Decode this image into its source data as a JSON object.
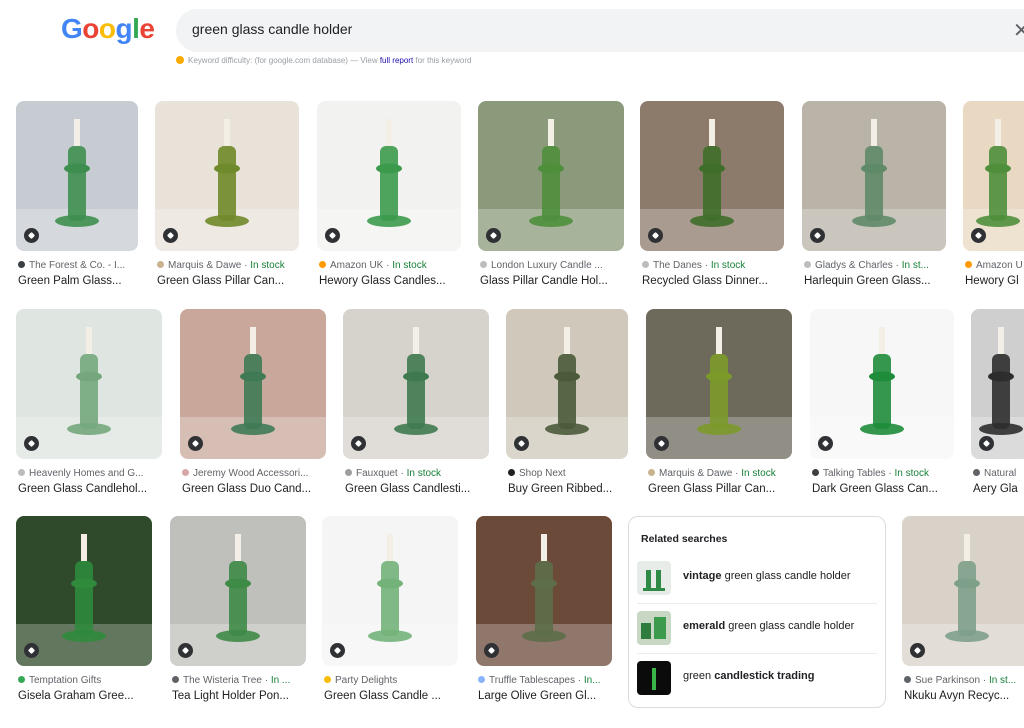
{
  "logo": {
    "letters": [
      "G",
      "o",
      "o",
      "g",
      "l",
      "e"
    ],
    "colors": [
      "#4285f4",
      "#ea4335",
      "#fbbc05",
      "#4285f4",
      "#34a853",
      "#ea4335"
    ]
  },
  "search": {
    "query": "green glass candle holder",
    "clear_icon": "close-icon"
  },
  "keyword": {
    "label": "Keyword difficulty:",
    "db": "(for google.com database) — View",
    "link": "full report",
    "tail": "for this keyword"
  },
  "results": [
    {
      "source": "The Forest & Co. - I...",
      "stock": "",
      "title": "Green Palm Glass...",
      "fav": "#3c4043",
      "bg": "#c7ccd2",
      "fg": "#3e8f4f"
    },
    {
      "source": "Marquis & Dawe",
      "stock": "In stock",
      "title": "Green Glass Pillar Can...",
      "fav": "#c9b38f",
      "bg": "#e8e2d8",
      "fg": "#6f8a2a"
    },
    {
      "source": "Amazon UK",
      "stock": "In stock",
      "title": "Hewory Glass Candles...",
      "fav": "#ff9900",
      "bg": "#f2f2f0",
      "fg": "#3c9a4d"
    },
    {
      "source": "London Luxury Candle ...",
      "stock": "",
      "title": "Glass Pillar Candle Hol...",
      "fav": "#bdbdbd",
      "bg": "#8a9a7a",
      "fg": "#4f8f3c"
    },
    {
      "source": "The Danes",
      "stock": "In stock",
      "title": "Recycled Glass Dinner...",
      "fav": "#bdbdbd",
      "bg": "#8c7a6a",
      "fg": "#3f6e2a"
    },
    {
      "source": "Gladys & Charles",
      "stock": "In st...",
      "title": "Harlequin Green Glass...",
      "fav": "#bdbdbd",
      "bg": "#b9b3a8",
      "fg": "#5f8a68"
    },
    {
      "source": "Amazon U",
      "stock": "",
      "title": "Hewory Gl",
      "fav": "#ff9900",
      "bg": "#e9d8c2",
      "fg": "#4f8f3c"
    },
    {
      "source": "Heavenly Homes and G...",
      "stock": "",
      "title": "Green Glass Candlehol...",
      "fav": "#bdbdbd",
      "bg": "#dfe5e0",
      "fg": "#74a87c"
    },
    {
      "source": "Jeremy Wood Accessori...",
      "stock": "",
      "title": "Green Glass Duo Cand...",
      "fav": "#d7a7a7",
      "bg": "#c9a89b",
      "fg": "#3f7a55"
    },
    {
      "source": "Fauxquet",
      "stock": "In stock",
      "title": "Green Glass Candlesti...",
      "fav": "#9e9e9e",
      "bg": "#d6d2cc",
      "fg": "#3f7a4f"
    },
    {
      "source": "Shop Next",
      "stock": "",
      "title": "Buy Green Ribbed...",
      "fav": "#202124",
      "bg": "#cfc8bb",
      "fg": "#4a5a3a"
    },
    {
      "source": "Marquis & Dawe",
      "stock": "In stock",
      "title": "Green Glass Pillar Can...",
      "fav": "#c9b38f",
      "bg": "#6d6a5c",
      "fg": "#7c9a2a"
    },
    {
      "source": "Talking Tables",
      "stock": "In stock",
      "title": "Dark Green Glass Can...",
      "fav": "#3c4043",
      "bg": "#f7f7f7",
      "fg": "#1e8c3a"
    },
    {
      "source": "Natural",
      "stock": "",
      "title": "Aery Gla",
      "fav": "#5f6368",
      "bg": "#cfcfcf",
      "fg": "#2d2d2d"
    },
    {
      "source": "Temptation Gifts",
      "stock": "",
      "title": "Gisela Graham Gree...",
      "fav": "#34a853",
      "bg": "#2f4a2a",
      "fg": "#2f8a3c"
    },
    {
      "source": "The Wisteria Tree",
      "stock": "In ...",
      "title": "Tea Light Holder Pon...",
      "fav": "#5f6368",
      "bg": "#bfc0bb",
      "fg": "#3e8a47"
    },
    {
      "source": "Party Delights",
      "stock": "",
      "title": "Green Glass Candle ...",
      "fav": "#fbbc05",
      "bg": "#f5f5f5",
      "fg": "#73b37a"
    },
    {
      "source": "Truffle Tablescapes",
      "stock": "In...",
      "title": "Large Olive Green Gl...",
      "fav": "#8ab4f8",
      "bg": "#6b4a3a",
      "fg": "#5d6e4a"
    },
    {
      "source": "Sue Parkinson",
      "stock": "In st...",
      "title": "Nkuku Avyn Recyc...",
      "fav": "#5f6368",
      "bg": "#d8d2c8",
      "fg": "#7ea08a"
    }
  ],
  "related": {
    "title": "Related searches",
    "items": [
      {
        "bold": "vintage",
        "rest": " green glass candle holder"
      },
      {
        "bold": "emerald",
        "rest": " green glass candle holder"
      },
      {
        "pre": "green ",
        "bold": "candlestick trading",
        "rest": ""
      }
    ]
  }
}
